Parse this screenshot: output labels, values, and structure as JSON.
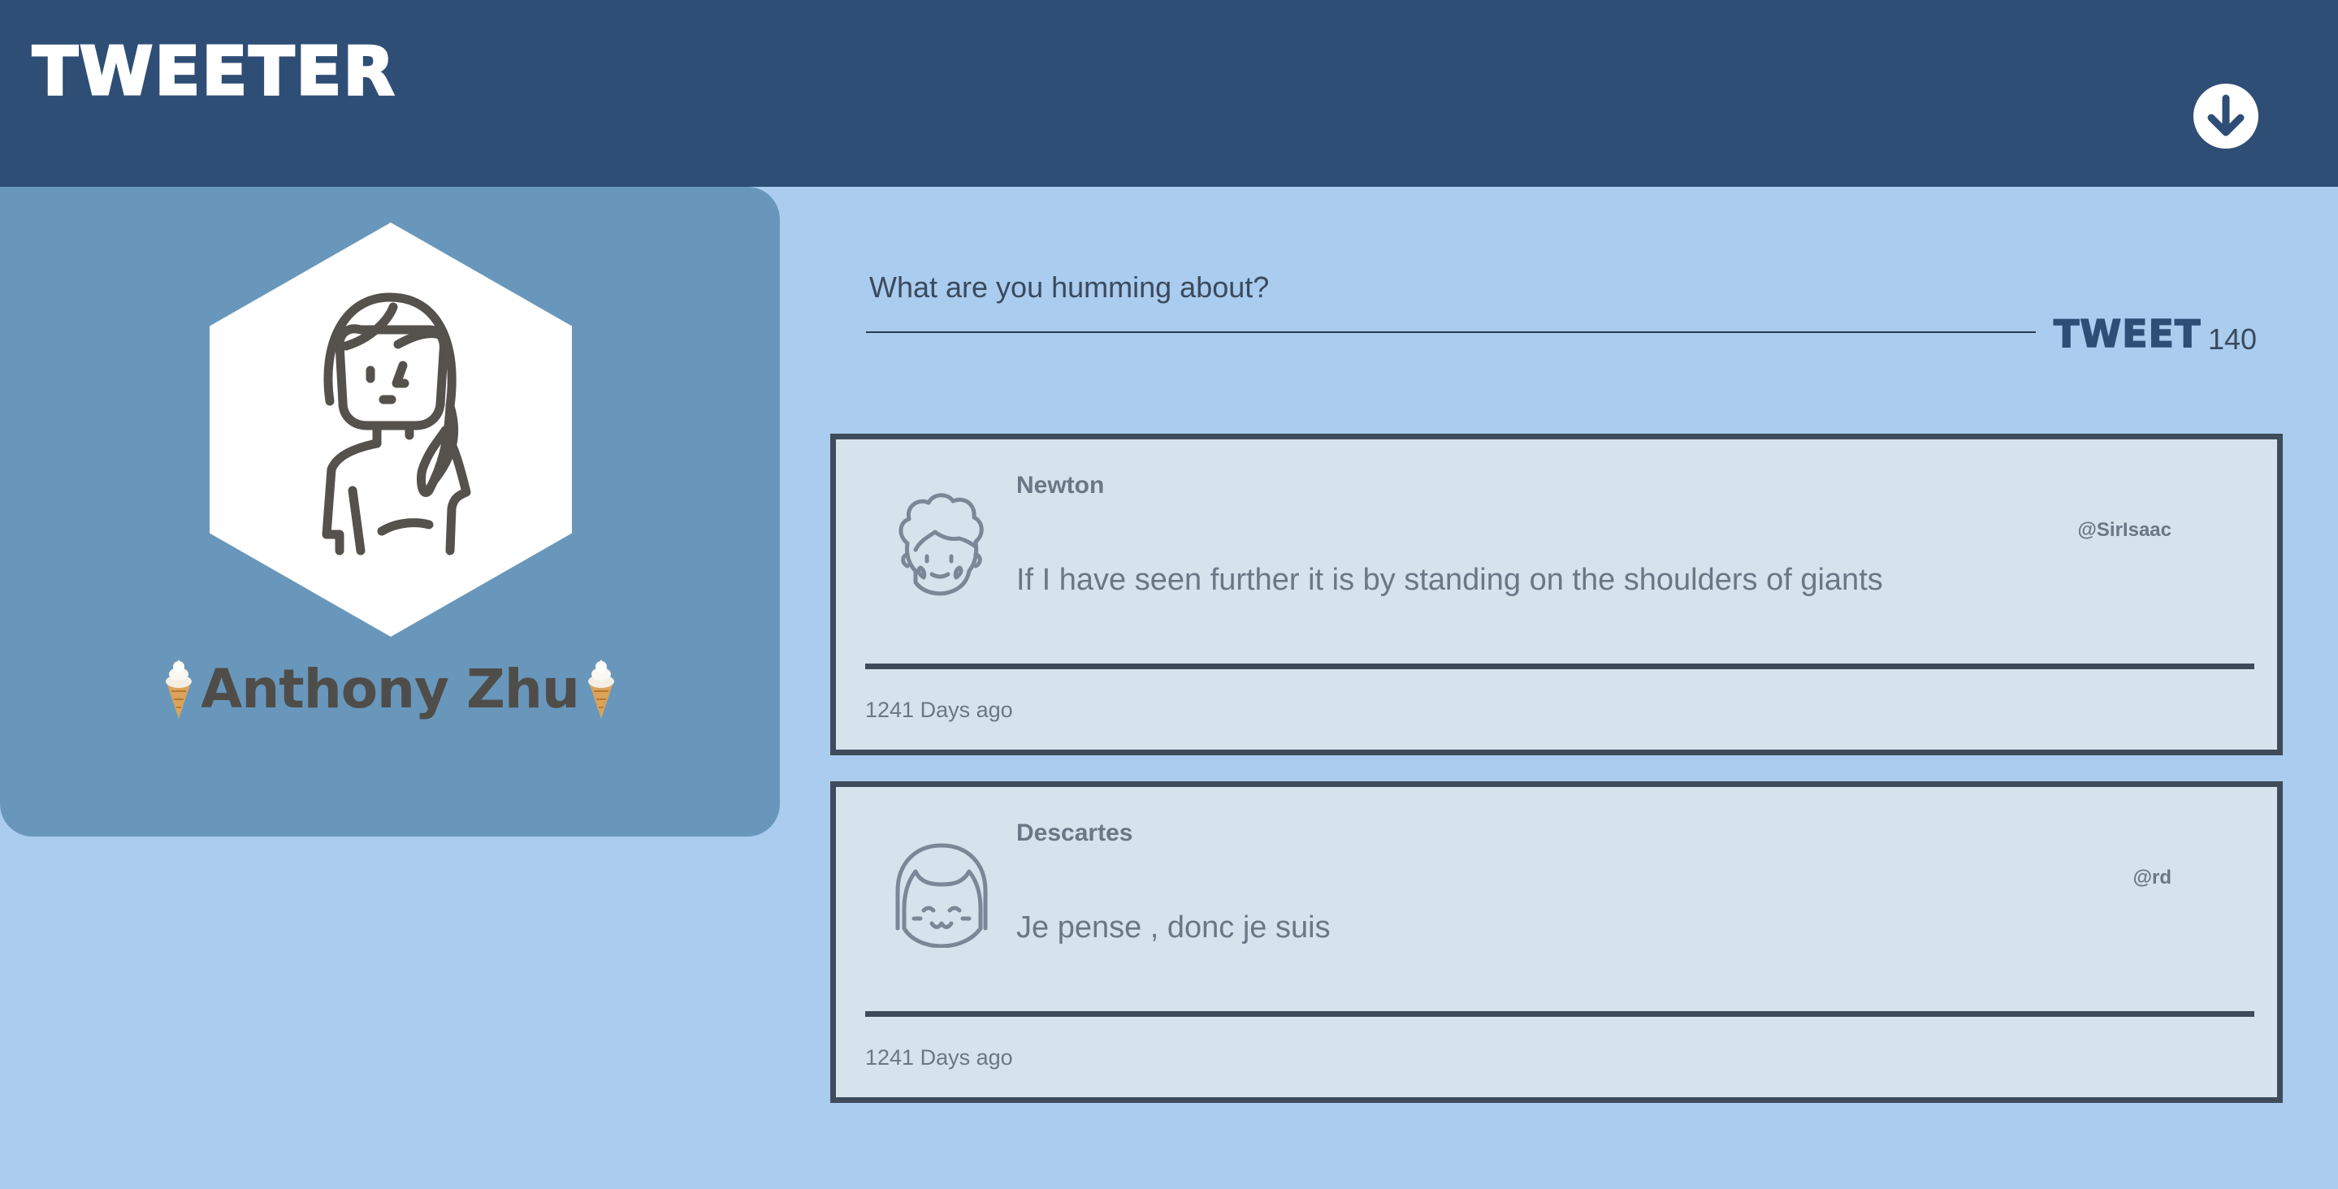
{
  "header": {
    "brand": "TWEETER",
    "nav_icon": "arrow-down-circle-icon"
  },
  "profile": {
    "avatar_icon": "woman-long-hair-icon",
    "emoji_icon": "ice-cream-cone-icon",
    "name": "Anthony Zhu"
  },
  "composer": {
    "placeholder": "What are you humming about?",
    "value": "",
    "button_label": "TWEET",
    "char_count": "140"
  },
  "tweets": [
    {
      "avatar_icon": "curly-hair-face-icon",
      "name": "Newton",
      "handle": "@SirIsaac",
      "text": "If I have seen further it is by standing on the shoulders of giants",
      "time": "1241 Days ago"
    },
    {
      "avatar_icon": "bob-hair-face-icon",
      "name": "Descartes",
      "handle": "@rd",
      "text": "Je pense , donc je suis",
      "time": "1241 Days ago"
    }
  ],
  "colors": {
    "header_bg": "#2f4e75",
    "page_bg": "#a9ccef",
    "profile_card_bg": "#6997bb",
    "tweet_bg": "#d6e2ec",
    "tweet_border": "#3e4b5a"
  }
}
